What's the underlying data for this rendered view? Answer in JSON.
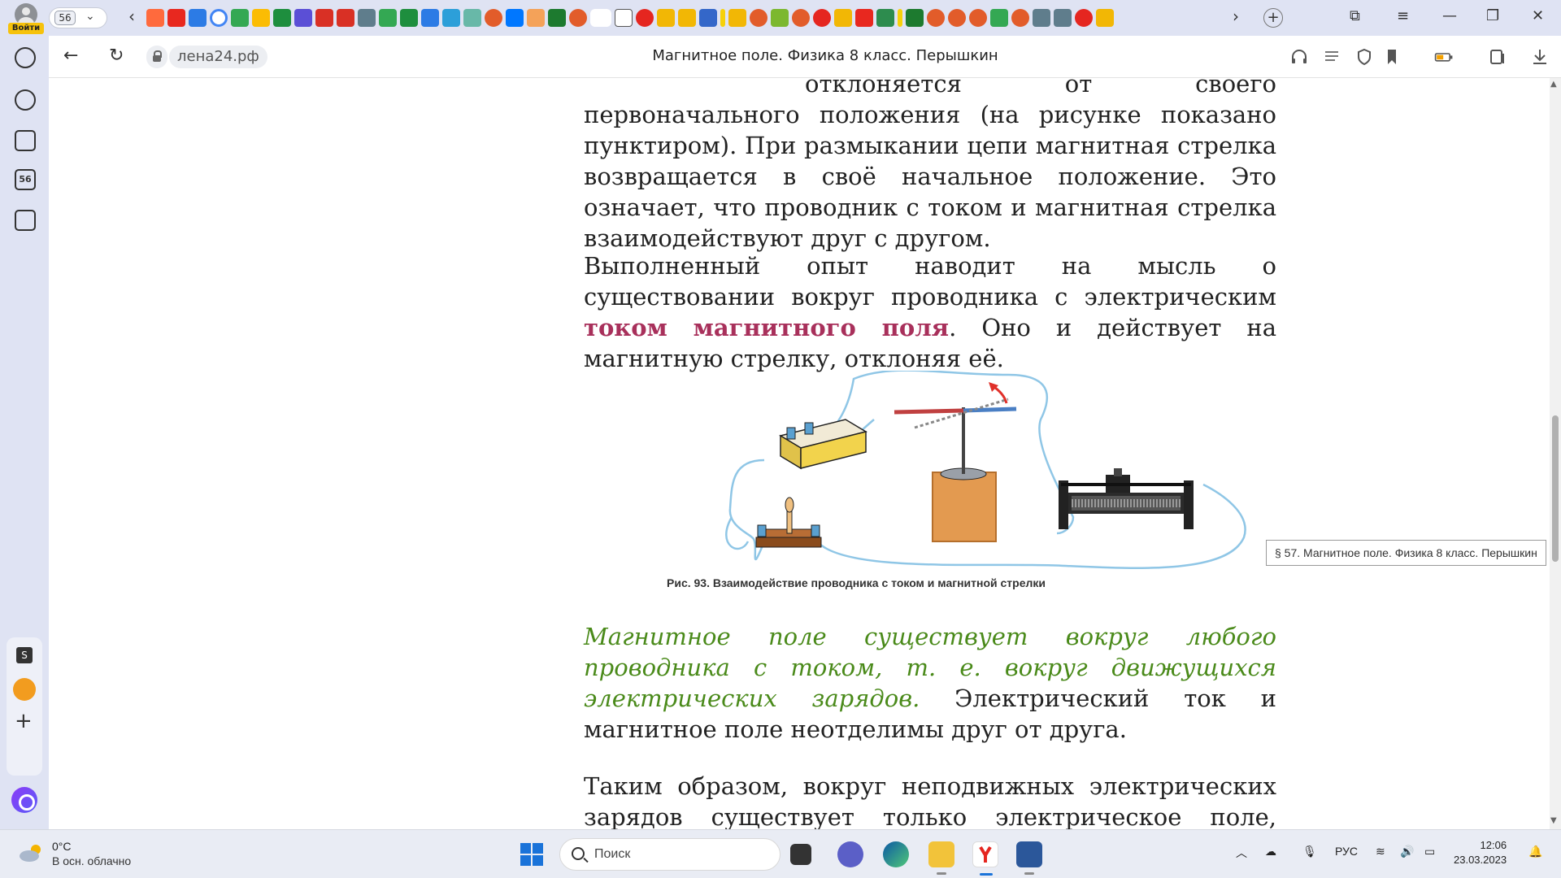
{
  "profile": {
    "login_label": "Войти"
  },
  "tabs": {
    "count": "56"
  },
  "addressbar": {
    "url": "лена24.рф",
    "page_title": "Магнитное поле. Физика 8 класс. Перышкин"
  },
  "sidebar": {
    "badge": "56"
  },
  "article": {
    "p1": "отклоняется от своего первоначального положения (на рисунке показано пунктиром). При размыкании цепи магнитная стрелка возвращается в своё начальное положение. Это означает, что проводник с током и магнитная стрелка взаимодействуют друг с другом.",
    "p2_a": "Выполненный опыт наводит на мысль о существовании вокруг проводника с электрическим ",
    "p2_highlight": "током магнитного поля",
    "p2_b": ". Оно и действует на магнитную стрелку, отклоняя её.",
    "figure_caption": "Рис. 93. Взаимодействие проводника с током и магнитной стрелки",
    "p3_green": "Магнитное поле существует вокруг любого проводника с током, т. е. вокруг движущихся электрических зарядов.",
    "p3_rest": " Электрический ток и магнитное поле неотделимы друг от друга.",
    "p4": "Таким образом, вокруг неподвижных электрических зарядов существует только электрическое поле, вокруг"
  },
  "tooltip": {
    "text": "§ 57. Магнитное поле. Физика 8 класс. Перышкин"
  },
  "taskbar": {
    "weather_temp": "0°C",
    "weather_desc": "В осн. облачно",
    "search_placeholder": "Поиск",
    "language": "РУС",
    "time": "12:06",
    "date": "23.03.2023"
  },
  "colors": {
    "highlight": "#a8305b",
    "green_text": "#4a8a1a",
    "chrome": "#dfe3f3"
  }
}
